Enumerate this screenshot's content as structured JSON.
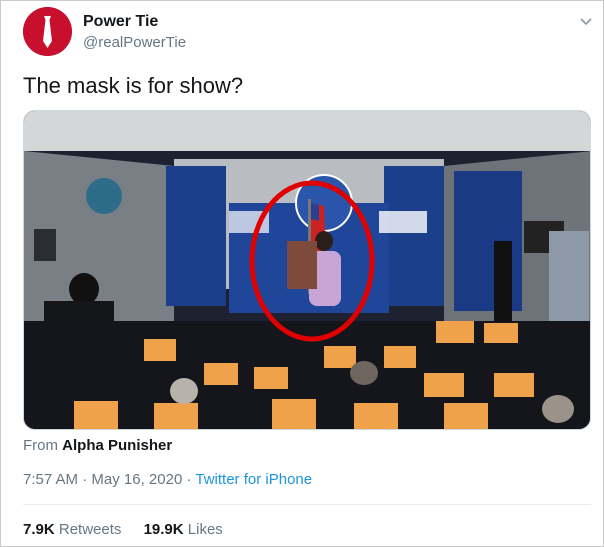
{
  "user": {
    "name": "Power Tie",
    "handle": "@realPowerTie",
    "avatar_icon": "tie-icon",
    "avatar_color": "#c8102e"
  },
  "tweet": {
    "text": "The mask is for show?",
    "media_icon": "press-room-video-thumbnail",
    "from_prefix": "From",
    "from_source": "Alpha Punisher",
    "time": "7:57 AM",
    "separator": "·",
    "date": "May 16, 2020",
    "client": "Twitter for iPhone"
  },
  "stats": {
    "retweets_count": "7.9K",
    "retweets_label": "Retweets",
    "likes_count": "19.9K",
    "likes_label": "Likes"
  },
  "colors": {
    "link": "#1b95e0",
    "secondary_text": "#657786",
    "circle_highlight": "#e00000"
  }
}
